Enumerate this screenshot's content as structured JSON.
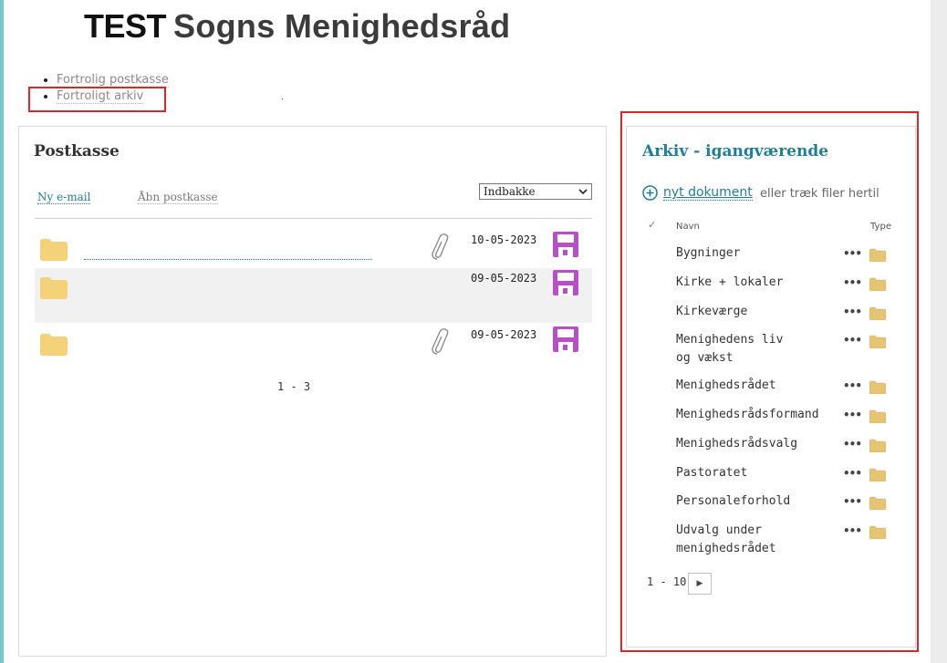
{
  "header": {
    "brand": "TEST",
    "parish_name": "Sogns Menighedsråd"
  },
  "top_links": [
    {
      "label": "Fortrolig postkasse"
    },
    {
      "label": "Fortroligt arkiv"
    }
  ],
  "mailbox": {
    "title": "Postkasse",
    "new_email": "Ny e-mail",
    "open_mailbox": "Åbn postkasse",
    "folder_selected": "Indbakke",
    "messages": [
      {
        "date": "10-05-2023",
        "has_attachment": true,
        "icon": "folder-icon"
      },
      {
        "date": "09-05-2023",
        "has_attachment": false,
        "icon": "folder-icon"
      },
      {
        "date": "09-05-2023",
        "has_attachment": true,
        "icon": "folder-icon"
      }
    ],
    "pager": "1 - 3"
  },
  "archive": {
    "title": "Arkiv - igangværende",
    "new_document_link": "nyt dokument",
    "new_document_hint": "eller træk filer hertil",
    "column_name": "Navn",
    "column_type": "Type",
    "items": [
      {
        "label": "Bygninger",
        "menu": "•••"
      },
      {
        "label": "Kirke + lokaler",
        "menu": "•••"
      },
      {
        "label": "Kirkeværge",
        "menu": "•••"
      },
      {
        "label": "Menighedens liv og vækst",
        "menu": "•••"
      },
      {
        "label": "Menighedsrådet",
        "menu": "•••"
      },
      {
        "label": "Menighedsrådsformand",
        "menu": "•••"
      },
      {
        "label": "Menighedsrådsvalg",
        "menu": "•••"
      },
      {
        "label": "Pastoratet",
        "menu": "•••"
      },
      {
        "label": "Personaleforhold",
        "menu": "•••"
      },
      {
        "label": "Udvalg under menighedsrådet",
        "menu": "•••"
      }
    ],
    "pager": "1 - 10"
  },
  "colors": {
    "accent": "#1f7e99",
    "highlight": "#e0242e",
    "save_icon": "#b94fc6",
    "folder_icon": "#f3d27a"
  }
}
